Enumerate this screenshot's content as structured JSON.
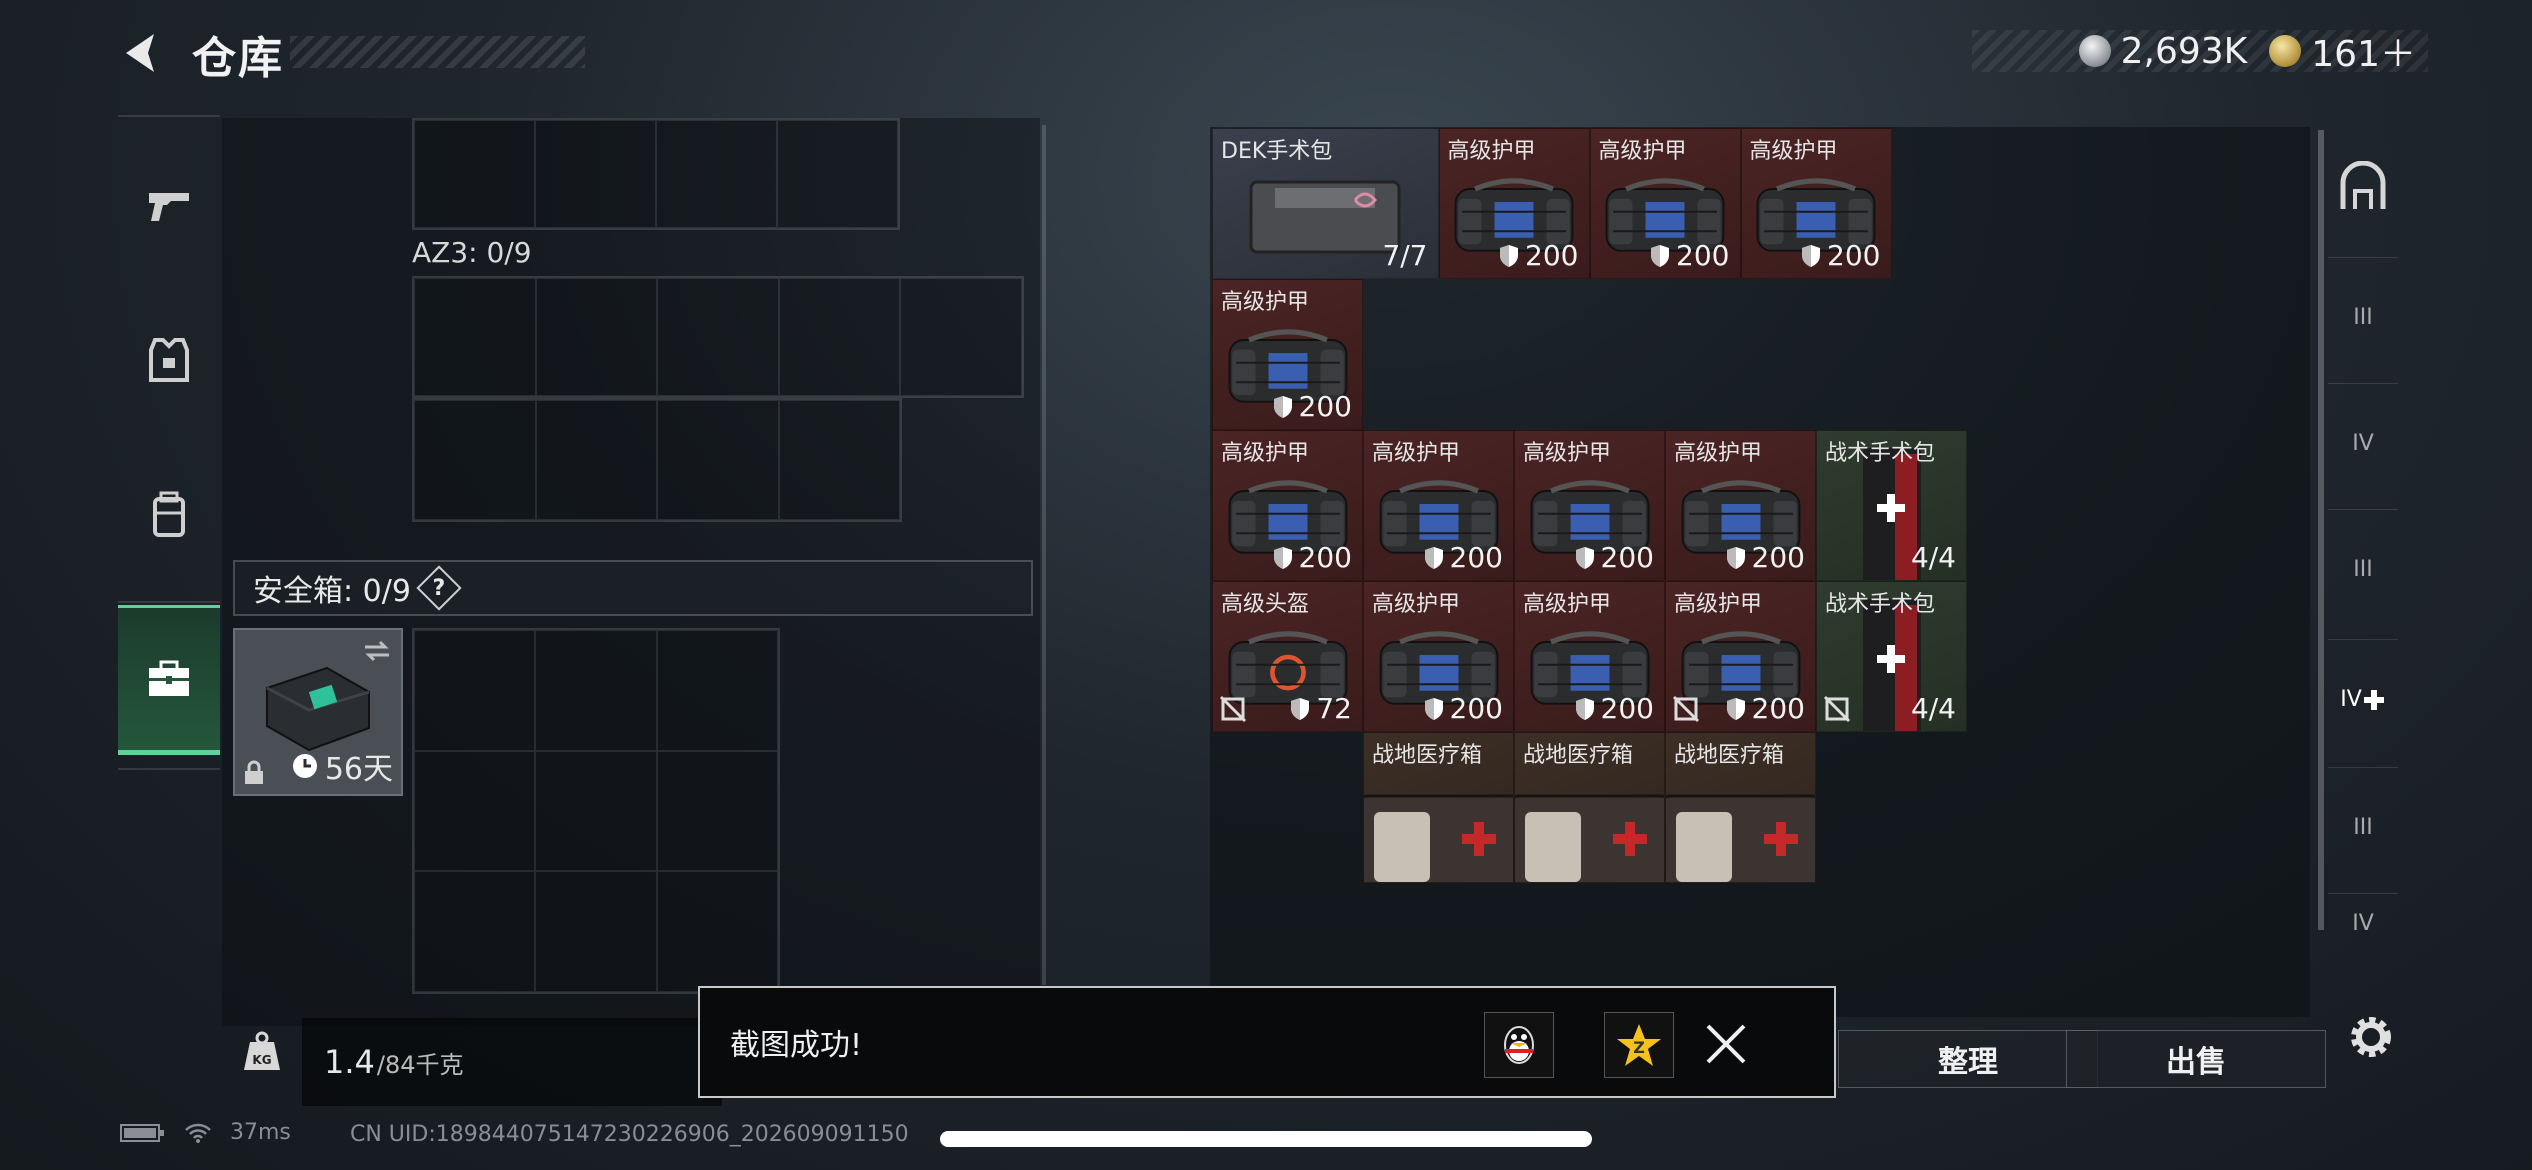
{
  "header": {
    "title": "仓库",
    "currency": [
      {
        "icon": "silver-coin-icon",
        "value": "2,693K"
      },
      {
        "icon": "gold-coin-icon",
        "value": "161＋"
      }
    ]
  },
  "left_tabs": [
    {
      "icon": "pistol-icon",
      "active": false
    },
    {
      "icon": "armor-vest-icon",
      "active": false
    },
    {
      "icon": "backpack-icon",
      "active": false
    },
    {
      "icon": "briefcase-icon",
      "active": true
    }
  ],
  "containers": {
    "az3_label": "AZ3: 0/9",
    "safe_label": "安全箱: 0/9",
    "help_label": "?",
    "safe_days": "56天"
  },
  "weight": {
    "current": "1.4",
    "max": "/84千克"
  },
  "inventory": [
    {
      "name": "DEK手术包",
      "value": "7/7",
      "color": "blue",
      "kind": "kit",
      "shield": false,
      "nosell": false
    },
    {
      "name": "高级护甲",
      "value": "200",
      "color": "red",
      "kind": "armor",
      "shield": true,
      "nosell": false
    },
    {
      "name": "高级护甲",
      "value": "200",
      "color": "red",
      "kind": "armor",
      "shield": true,
      "nosell": false
    },
    {
      "name": "高级护甲",
      "value": "200",
      "color": "red",
      "kind": "armor",
      "shield": true,
      "nosell": false
    },
    {
      "name": "高级护甲",
      "value": "200",
      "color": "red",
      "kind": "armor",
      "shield": true,
      "nosell": false
    },
    {
      "name": "高级护甲",
      "value": "200",
      "color": "red",
      "kind": "armor",
      "shield": true,
      "nosell": false
    },
    {
      "name": "高级护甲",
      "value": "200",
      "color": "red",
      "kind": "armor",
      "shield": true,
      "nosell": false
    },
    {
      "name": "高级护甲",
      "value": "200",
      "color": "red",
      "kind": "armor",
      "shield": true,
      "nosell": false
    },
    {
      "name": "战术手术包",
      "value": "4/4",
      "color": "green",
      "kind": "medkit",
      "shield": false,
      "nosell": false
    },
    {
      "name": "高级护甲",
      "value": "200",
      "color": "red",
      "kind": "armor",
      "shield": true,
      "nosell": false
    },
    {
      "name": "高级护甲",
      "value": "200",
      "color": "red",
      "kind": "armor",
      "shield": true,
      "nosell": false
    },
    {
      "name": "高级护甲",
      "value": "200",
      "color": "red",
      "kind": "armor",
      "shield": true,
      "nosell": false
    },
    {
      "name": "高级护甲",
      "value": "200",
      "color": "red",
      "kind": "armor",
      "shield": true,
      "nosell": true
    },
    {
      "name": "战术手术包",
      "value": "4/4",
      "color": "green",
      "kind": "medkit",
      "shield": false,
      "nosell": true
    },
    {
      "name": "高级头盔",
      "value": "72",
      "color": "red",
      "kind": "helmet",
      "shield": true,
      "nosell": true
    },
    {
      "name": "战地医疗箱",
      "value": "",
      "color": "brown",
      "kind": "fieldbox",
      "shield": false,
      "nosell": false
    },
    {
      "name": "战地医疗箱",
      "value": "",
      "color": "brown",
      "kind": "fieldbox",
      "shield": false,
      "nosell": false
    },
    {
      "name": "战地医疗箱",
      "value": "",
      "color": "brown",
      "kind": "fieldbox",
      "shield": false,
      "nosell": false
    }
  ],
  "right_categories": [
    "",
    "III",
    "IV",
    "III",
    "IV",
    "III",
    "IV"
  ],
  "actions": {
    "sort_label": "整理",
    "sell_label": "出售"
  },
  "toast": {
    "text": "截图成功!"
  },
  "status": {
    "ping": "37ms",
    "uid": "CN UID:189844075147230226906_202609091150"
  }
}
